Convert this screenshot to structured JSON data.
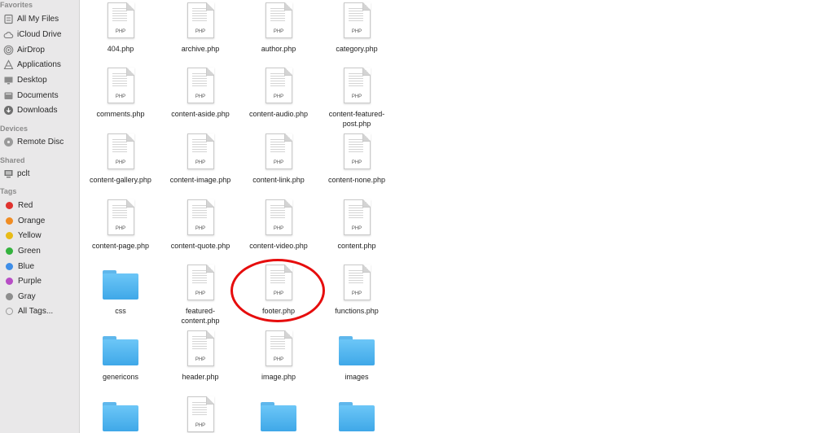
{
  "sidebar": {
    "favorites_header": "Favorites",
    "favorites": [
      {
        "label": "All My Files",
        "icon": "all-files-icon"
      },
      {
        "label": "iCloud Drive",
        "icon": "cloud-icon"
      },
      {
        "label": "AirDrop",
        "icon": "airdrop-icon"
      },
      {
        "label": "Applications",
        "icon": "applications-icon"
      },
      {
        "label": "Desktop",
        "icon": "desktop-icon"
      },
      {
        "label": "Documents",
        "icon": "documents-icon"
      },
      {
        "label": "Downloads",
        "icon": "downloads-icon"
      }
    ],
    "devices_header": "Devices",
    "devices": [
      {
        "label": "Remote Disc",
        "icon": "disc-icon"
      }
    ],
    "shared_header": "Shared",
    "shared": [
      {
        "label": "pclt",
        "icon": "computer-icon"
      }
    ],
    "tags_header": "Tags",
    "tags": [
      {
        "label": "Red",
        "color": "#e0332f"
      },
      {
        "label": "Orange",
        "color": "#f08c23"
      },
      {
        "label": "Yellow",
        "color": "#e8bb17"
      },
      {
        "label": "Green",
        "color": "#34b23e"
      },
      {
        "label": "Blue",
        "color": "#3f8ee8"
      },
      {
        "label": "Purple",
        "color": "#b74dc5"
      },
      {
        "label": "Gray",
        "color": "#8e8e8e"
      },
      {
        "label": "All Tags...",
        "color": ""
      }
    ]
  },
  "files": [
    {
      "name": "404.php",
      "kind": "php"
    },
    {
      "name": "archive.php",
      "kind": "php"
    },
    {
      "name": "author.php",
      "kind": "php"
    },
    {
      "name": "category.php",
      "kind": "php"
    },
    {
      "name": "comments.php",
      "kind": "php"
    },
    {
      "name": "content-aside.php",
      "kind": "php"
    },
    {
      "name": "content-audio.php",
      "kind": "php"
    },
    {
      "name": "content-featured-post.php",
      "kind": "php"
    },
    {
      "name": "content-gallery.php",
      "kind": "php"
    },
    {
      "name": "content-image.php",
      "kind": "php"
    },
    {
      "name": "content-link.php",
      "kind": "php"
    },
    {
      "name": "content-none.php",
      "kind": "php"
    },
    {
      "name": "content-page.php",
      "kind": "php"
    },
    {
      "name": "content-quote.php",
      "kind": "php"
    },
    {
      "name": "content-video.php",
      "kind": "php"
    },
    {
      "name": "content.php",
      "kind": "php"
    },
    {
      "name": "css",
      "kind": "folder"
    },
    {
      "name": "featured-content.php",
      "kind": "php"
    },
    {
      "name": "footer.php",
      "kind": "php"
    },
    {
      "name": "functions.php",
      "kind": "php"
    },
    {
      "name": "genericons",
      "kind": "folder"
    },
    {
      "name": "header.php",
      "kind": "php"
    },
    {
      "name": "image.php",
      "kind": "php"
    },
    {
      "name": "images",
      "kind": "folder"
    },
    {
      "name": "",
      "kind": "folder"
    },
    {
      "name": "",
      "kind": "php"
    },
    {
      "name": "",
      "kind": "folder"
    },
    {
      "name": "",
      "kind": "folder"
    }
  ],
  "file_badge": "PHP",
  "highlighted_file": "footer.php",
  "highlight_color": "#e60d0d"
}
